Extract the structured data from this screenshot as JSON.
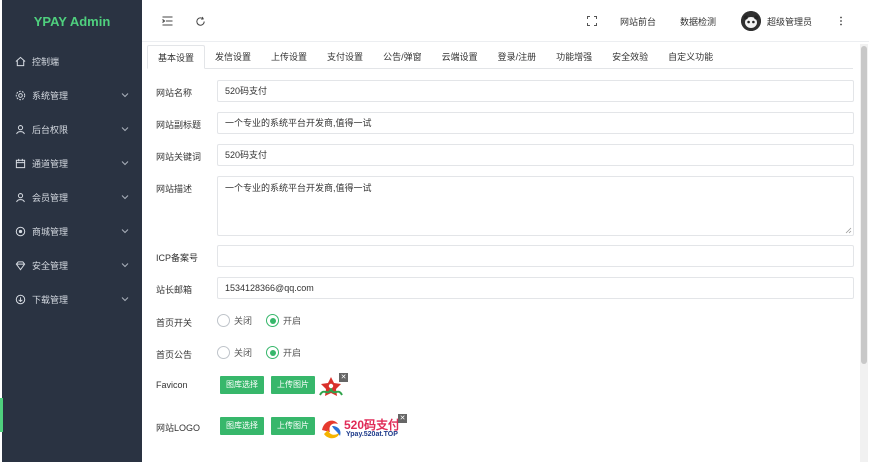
{
  "brand": {
    "title": "YPAY Admin",
    "color": "#4fd07e"
  },
  "sidebar": {
    "items": [
      {
        "label": "控制端",
        "icon": "home-icon",
        "has_submenu": false
      },
      {
        "label": "系统管理",
        "icon": "gear-icon",
        "has_submenu": true
      },
      {
        "label": "后台权限",
        "icon": "user-icon",
        "has_submenu": true
      },
      {
        "label": "通道管理",
        "icon": "calendar-icon",
        "has_submenu": true
      },
      {
        "label": "会员管理",
        "icon": "user-icon",
        "has_submenu": true
      },
      {
        "label": "商城管理",
        "icon": "shop-icon",
        "has_submenu": true
      },
      {
        "label": "安全管理",
        "icon": "diamond-icon",
        "has_submenu": true
      },
      {
        "label": "下载管理",
        "icon": "download-icon",
        "has_submenu": true
      }
    ]
  },
  "header": {
    "links": [
      "网站前台",
      "数据检测"
    ],
    "user": "超级管理员",
    "icons": [
      "menu-fold-icon",
      "refresh-icon",
      "fullscreen-icon",
      "more-icon"
    ]
  },
  "tabs": [
    {
      "label": "基本设置",
      "active": true
    },
    {
      "label": "发信设置",
      "active": false
    },
    {
      "label": "上传设置",
      "active": false
    },
    {
      "label": "支付设置",
      "active": false
    },
    {
      "label": "公告/弹窗",
      "active": false
    },
    {
      "label": "云端设置",
      "active": false
    },
    {
      "label": "登录/注册",
      "active": false
    },
    {
      "label": "功能增强",
      "active": false
    },
    {
      "label": "安全效验",
      "active": false
    },
    {
      "label": "自定义功能",
      "active": false
    }
  ],
  "form": {
    "site_name": {
      "label": "网站名称",
      "value": "520码支付"
    },
    "subtitle": {
      "label": "网站副标题",
      "value": "一个专业的系统平台开发商,值得一试"
    },
    "keywords": {
      "label": "网站关键词",
      "value": "520码支付"
    },
    "description": {
      "label": "网站描述",
      "value": "一个专业的系统平台开发商,值得一试"
    },
    "icp": {
      "label": "ICP备案号",
      "value": ""
    },
    "email": {
      "label": "站长邮箱",
      "value": "1534128366@qq.com"
    },
    "home_switch": {
      "label": "首页开关",
      "options": [
        "关闭",
        "开启"
      ],
      "selected": "开启"
    },
    "home_notice": {
      "label": "首页公告",
      "options": [
        "关闭",
        "开启"
      ],
      "selected": "开启"
    },
    "favicon": {
      "label": "Favicon",
      "buttons": [
        "图库选择",
        "上传图片"
      ]
    },
    "logo": {
      "label": "网站LOGO",
      "buttons": [
        "图库选择",
        "上传图片"
      ],
      "logo_text": "520码支付",
      "logo_sub": "Ypay.520at.TOP"
    }
  },
  "colors": {
    "sidebar": "#2a3342",
    "accent": "#37b76b"
  }
}
